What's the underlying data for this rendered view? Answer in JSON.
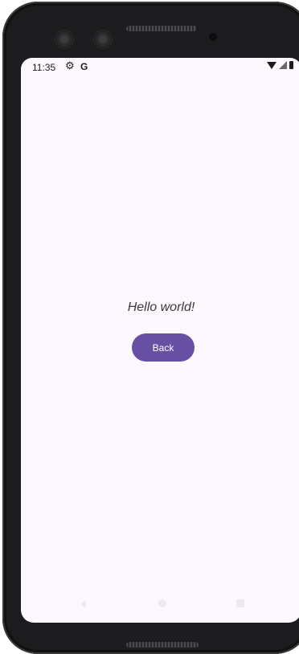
{
  "status_bar": {
    "time": "11:35",
    "left_icons": [
      "gear-icon",
      "google-g-icon"
    ],
    "google_label": "G",
    "right_icons": [
      "wifi-icon",
      "cell-signal-icon",
      "battery-icon"
    ]
  },
  "main": {
    "greeting": "Hello world!",
    "back_button_label": "Back"
  },
  "navigation_bar": {
    "buttons": [
      "nav-back",
      "nav-home",
      "nav-recents"
    ]
  },
  "colors": {
    "screen_background": "#fdf7ff",
    "button_background": "#6750a4",
    "button_text": "#ffffff",
    "phone_frame": "#1c1c1e"
  }
}
